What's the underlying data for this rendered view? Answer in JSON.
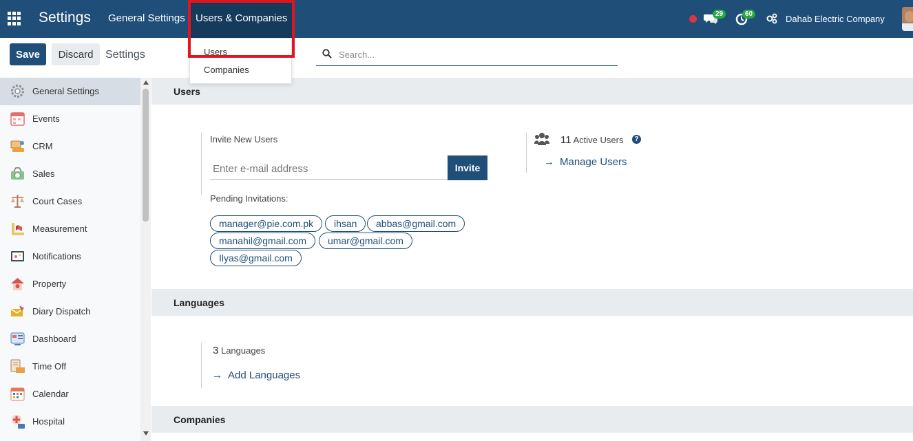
{
  "topbar": {
    "app_title": "Settings",
    "nav_general": "General Settings",
    "nav_users": "Users & Companies",
    "chat_count": "29",
    "activity_count": "60",
    "company": "Dahab Electric Company"
  },
  "dropdown": {
    "items": [
      "Users",
      "Companies"
    ]
  },
  "control": {
    "save": "Save",
    "discard": "Discard",
    "title": "Settings",
    "search_placeholder": "Search..."
  },
  "sidebar": {
    "items": [
      {
        "label": "General Settings",
        "icon": "gear-icon",
        "color": "#6c757d"
      },
      {
        "label": "Events",
        "icon": "calendar-event-icon",
        "color": "#e36d6d"
      },
      {
        "label": "CRM",
        "icon": "crm-icon",
        "color": "#e8a33b"
      },
      {
        "label": "Sales",
        "icon": "sales-icon",
        "color": "#5aa469"
      },
      {
        "label": "Court Cases",
        "icon": "scale-icon",
        "color": "#b07a58"
      },
      {
        "label": "Measurement",
        "icon": "ruler-icon",
        "color": "#e05a47"
      },
      {
        "label": "Notifications",
        "icon": "notification-icon",
        "color": "#3d4d5c"
      },
      {
        "label": "Property",
        "icon": "house-icon",
        "color": "#d9534f"
      },
      {
        "label": "Diary Dispatch",
        "icon": "envelope-icon",
        "color": "#e6b325"
      },
      {
        "label": "Dashboard",
        "icon": "dashboard-icon",
        "color": "#4a7bb7"
      },
      {
        "label": "Time Off",
        "icon": "time-off-icon",
        "color": "#e6a24a"
      },
      {
        "label": "Calendar",
        "icon": "calendar-icon",
        "color": "#e07a5f"
      },
      {
        "label": "Hospital",
        "icon": "hospital-icon",
        "color": "#d9534f"
      }
    ]
  },
  "users_section": {
    "title": "Users",
    "invite_label": "Invite New Users",
    "email_placeholder": "Enter e-mail address",
    "invite_button": "Invite",
    "pending_label": "Pending Invitations:",
    "pending": [
      "manager@pie.com.pk",
      "ihsan",
      "abbas@gmail.com",
      "manahil@gmail.com",
      "umar@gmail.com",
      "Ilyas@gmail.com"
    ],
    "active_count": "11",
    "active_label": "Active Users",
    "manage_link": "Manage Users"
  },
  "languages_section": {
    "title": "Languages",
    "count": "3",
    "count_label": "Languages",
    "add_link": "Add Languages"
  },
  "companies_section": {
    "title": "Companies"
  }
}
